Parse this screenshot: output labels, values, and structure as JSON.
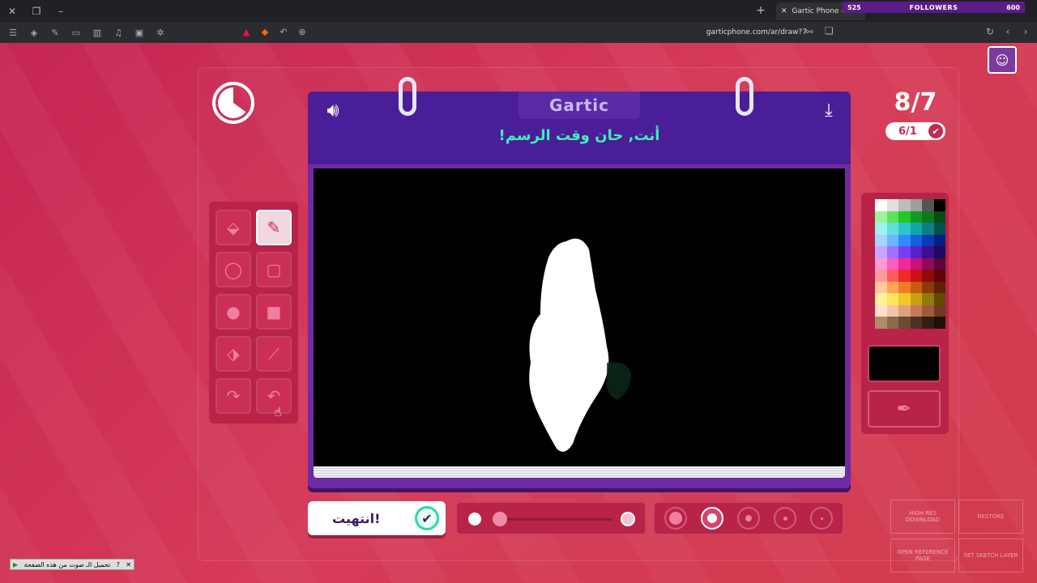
{
  "browser": {
    "tab_title": "Gartic Phone - ...",
    "url": "garticphone.com/ar/draw?7",
    "followers_left": "525",
    "followers_label": "FOLLOWERS",
    "followers_right": "600"
  },
  "game": {
    "logo": "Gartic",
    "prompt": "أنت, حان وقت الرسم!",
    "round_big": "8/7",
    "round_small": "6/1",
    "done_label": "انتهيت!",
    "side_buttons": {
      "high_res": "HIGH RES DOWNLOAD",
      "restore": "RESTORE",
      "open_ref": "OPEN REFERENCE PAGE",
      "set_sketch": "SET SKETCH LAYER"
    },
    "ad_text": "تحميل الـ صوت من هذه الصفحة"
  },
  "colors": {
    "accent": "#c52654",
    "notebook": "#6f2ba5",
    "title_green": "#3ff0b6"
  },
  "palette": [
    "#ffffff",
    "#e0e0e0",
    "#bdbdbd",
    "#9e9e9e",
    "#555555",
    "#000000",
    "#9cf59c",
    "#5be35b",
    "#24c824",
    "#0f9a1f",
    "#0b7a1a",
    "#064d12",
    "#a0f0f0",
    "#62dede",
    "#2cc8c8",
    "#13a6a6",
    "#0b8080",
    "#064f4f",
    "#a6d4ff",
    "#6cb6ff",
    "#2e8cff",
    "#1460e0",
    "#0b3cb4",
    "#061f80",
    "#c8a6ff",
    "#a070ff",
    "#7a3cf0",
    "#5a20c8",
    "#3c1090",
    "#200860",
    "#ff9ad6",
    "#ff5cc0",
    "#f0289c",
    "#c8127a",
    "#900a58",
    "#60043a",
    "#ff9a9a",
    "#ff5c5c",
    "#f02828",
    "#c81212",
    "#900a0a",
    "#600404",
    "#ffc89a",
    "#ffa45c",
    "#f07a28",
    "#c85a12",
    "#903a0a",
    "#602004",
    "#fff09a",
    "#ffe45c",
    "#f0c828",
    "#c8a012",
    "#907a0a",
    "#604a04",
    "#ffe0cc",
    "#f5c4a6",
    "#e0a080",
    "#c47a5a",
    "#a05a3a",
    "#703a20",
    "#b08a6a",
    "#8c6a4c",
    "#6a4c34",
    "#4c3220",
    "#321e12",
    "#1c1008"
  ]
}
